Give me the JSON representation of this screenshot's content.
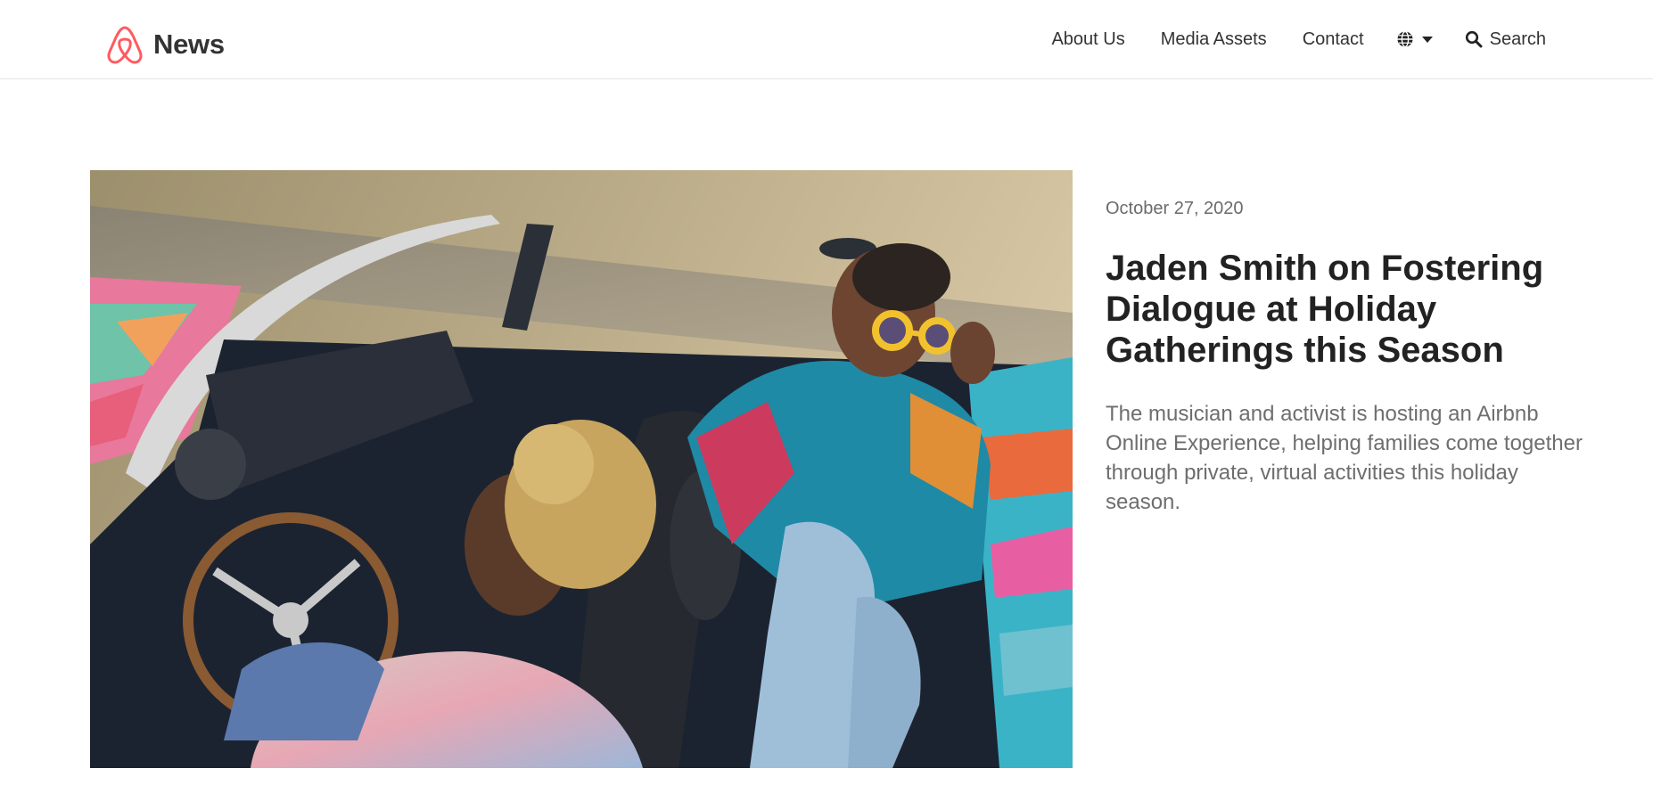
{
  "header": {
    "brand": {
      "icon": "airbnb-logo-icon",
      "name": "News",
      "color": "#ff5a5f"
    },
    "nav": [
      {
        "label": "About Us"
      },
      {
        "label": "Media Assets"
      },
      {
        "label": "Contact"
      }
    ],
    "language": {
      "icon": "globe-icon",
      "caret": "chevron-down-icon"
    },
    "search": {
      "icon": "search-icon",
      "label": "Search"
    }
  },
  "article": {
    "image": "Two people riding in a colorfully painted convertible sports car on a highway",
    "date": "October 27, 2020",
    "title": "Jaden Smith on Fostering Dialogue at Holiday Gatherings this Season",
    "summary": "The musician and activist is hosting an Airbnb Online Experience, helping families come together through private, virtual activities this holiday season."
  }
}
